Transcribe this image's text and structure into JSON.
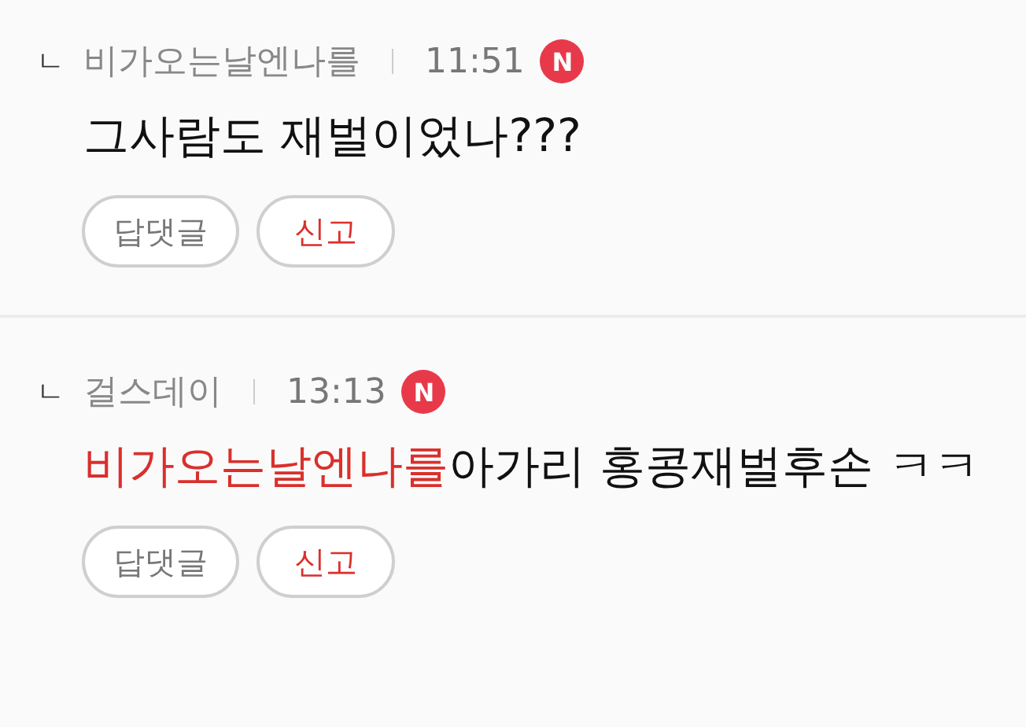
{
  "comments": [
    {
      "reply_mark": "ㄴ",
      "author": "비가오는날엔나를",
      "time": "11:51",
      "badge": "N",
      "text": "그사람도 재벌이었나???",
      "buttons": [
        {
          "label": "답댓글",
          "kind": "reply"
        },
        {
          "label": "신고",
          "kind": "report"
        }
      ]
    },
    {
      "reply_mark": "ㄴ",
      "author": "걸스데이",
      "time": "13:13",
      "badge": "N",
      "mention": "비가오는날엔나를",
      "text": "아가리 홍콩재벌후손 ㅋㅋ",
      "buttons": [
        {
          "label": "답댓글",
          "kind": "reply"
        },
        {
          "label": "신고",
          "kind": "report"
        }
      ]
    }
  ]
}
